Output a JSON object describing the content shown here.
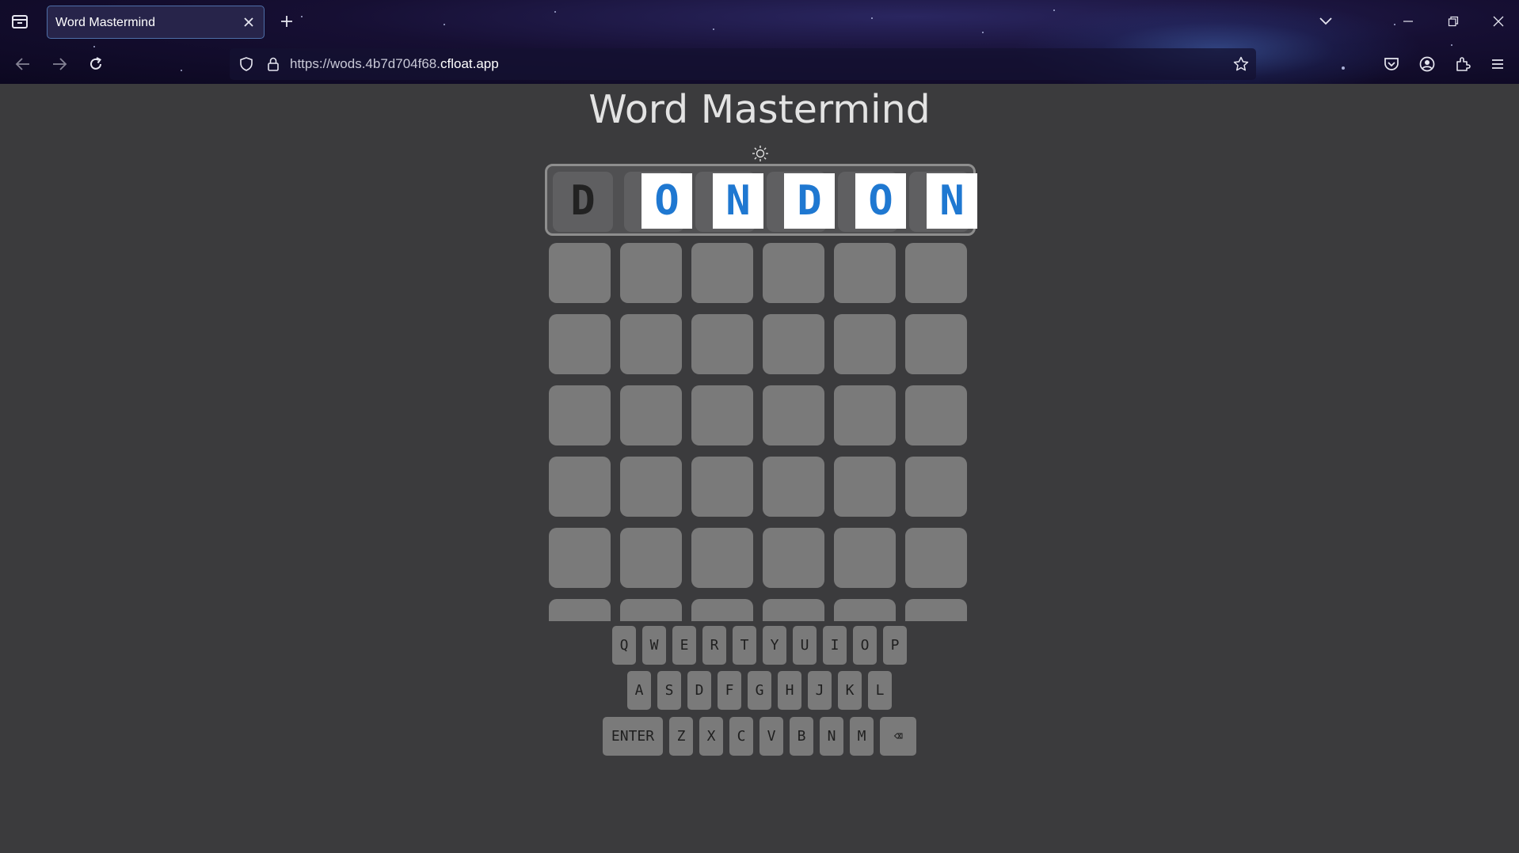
{
  "browser": {
    "tab_title": "Word Mastermind",
    "url_prefix": "https://wods.4b7d704f68.",
    "url_domain": "cfloat.app"
  },
  "page": {
    "title": "Word Mastermind",
    "theme_icon": "sun-icon"
  },
  "answer": {
    "letters": [
      "D",
      "O",
      "N",
      "D",
      "O",
      "N"
    ]
  },
  "grid": {
    "rows": 6,
    "cols": 6,
    "visible_partial_row": true
  },
  "keyboard": {
    "row1": [
      "Q",
      "W",
      "E",
      "R",
      "T",
      "Y",
      "U",
      "I",
      "O",
      "P"
    ],
    "row2": [
      "A",
      "S",
      "D",
      "F",
      "G",
      "H",
      "J",
      "K",
      "L"
    ],
    "row3": [
      "ENTER",
      "Z",
      "X",
      "C",
      "V",
      "B",
      "N",
      "M",
      "⌫"
    ]
  },
  "colors": {
    "page_bg": "#3b3b3d",
    "tile": "#7a7a7a",
    "answer_letter": "#1f78d1"
  }
}
